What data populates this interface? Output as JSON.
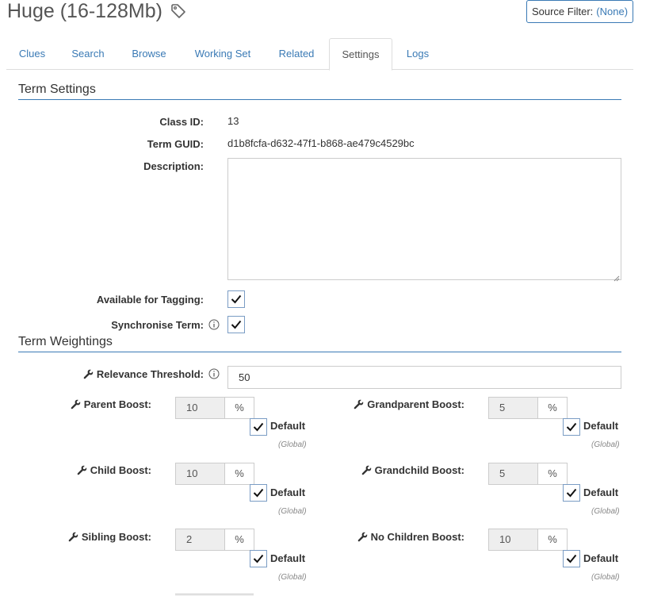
{
  "page": {
    "title": "Huge (16-128Mb)",
    "source_filter_label": "Source Filter:",
    "source_filter_value": "(None)"
  },
  "tabs": [
    {
      "label": "Clues",
      "active": false
    },
    {
      "label": "Search",
      "active": false
    },
    {
      "label": "Browse",
      "active": false
    },
    {
      "label": "Working Set",
      "active": false
    },
    {
      "label": "Related",
      "active": false
    },
    {
      "label": "Settings",
      "active": true
    },
    {
      "label": "Logs",
      "active": false
    }
  ],
  "term_settings": {
    "header": "Term Settings",
    "class_id_label": "Class ID:",
    "class_id_value": "13",
    "term_guid_label": "Term GUID:",
    "term_guid_value": "d1b8fcfa-d632-47f1-b868-ae479c4529bc",
    "description_label": "Description:",
    "description_value": "",
    "available_label": "Available for Tagging:",
    "available_checked": true,
    "synchronise_label": "Synchronise Term:",
    "synchronise_checked": true
  },
  "term_weightings": {
    "header": "Term Weightings",
    "relevance_label": "Relevance Threshold:",
    "relevance_value": "50",
    "default_label": "Default",
    "global_label": "(Global)",
    "percent": "%",
    "boosts": [
      {
        "label": "Parent Boost:",
        "value": "10",
        "default": true
      },
      {
        "label": "Grandparent Boost:",
        "value": "5",
        "default": true
      },
      {
        "label": "Child Boost:",
        "value": "10",
        "default": true
      },
      {
        "label": "Grandchild Boost:",
        "value": "5",
        "default": true
      },
      {
        "label": "Sibling Boost:",
        "value": "2",
        "default": true
      },
      {
        "label": "No Children Boost:",
        "value": "10",
        "default": true
      }
    ]
  },
  "colors": {
    "accent": "#3a7ab5",
    "text": "#333333",
    "muted": "#888888"
  }
}
